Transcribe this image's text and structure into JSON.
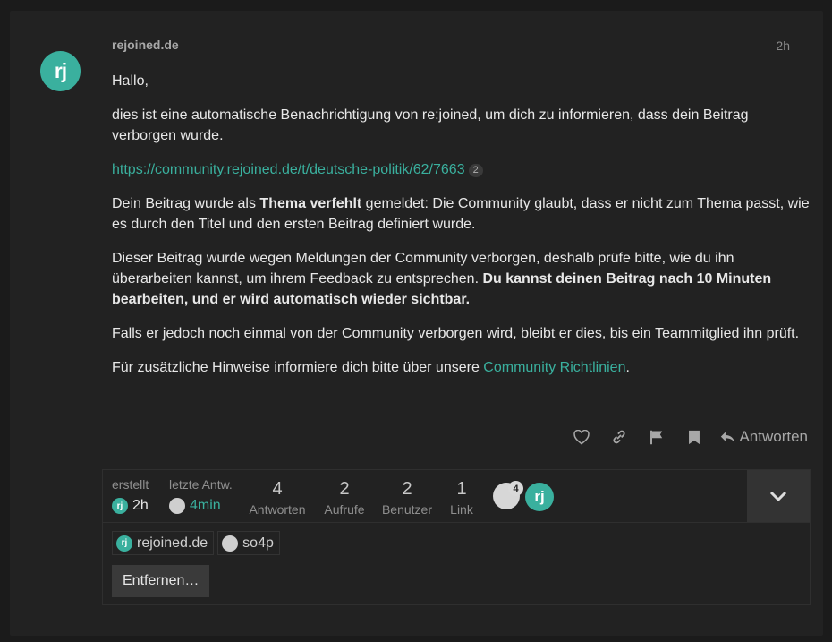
{
  "post": {
    "avatar_text": "rj",
    "username": "rejoined.de",
    "time": "2h",
    "greeting": "Hallo,",
    "intro": "dies ist eine automatische Benachrichtigung von re:joined, um dich zu informieren, dass dein Beitrag verborgen wurde.",
    "link_url": "https://community.rejoined.de/t/deutsche-politik/62/7663",
    "link_clicks": "2",
    "reason_prefix": "Dein Beitrag wurde als ",
    "reason_bold": "Thema verfehlt",
    "reason_suffix": " gemeldet: Die Community glaubt, dass er nicht zum Thema passt, wie es durch den Titel und den ersten Beitrag definiert wurde.",
    "hidden_text": "Dieser Beitrag wurde wegen Meldungen der Community verborgen, deshalb prüfe bitte, wie du ihn überarbeiten kannst, um ihrem Feedback zu entsprechen. ",
    "hidden_bold": "Du kannst deinen Beitrag nach 10 Minuten bearbeiten, und er wird automatisch wieder sichtbar.",
    "again_text": "Falls er jedoch noch einmal von der Community verborgen wird, bleibt er dies, bis ein Teammitglied ihn prüft.",
    "guidelines_prefix": "Für zusätzliche Hinweise informiere dich bitte über unsere ",
    "guidelines_link": "Community Richtlinien",
    "guidelines_suffix": "."
  },
  "actions": {
    "reply_label": "Antworten",
    "icons": [
      "heart-icon",
      "link-icon",
      "flag-icon",
      "bookmark-icon",
      "reply-icon"
    ]
  },
  "topic_map": {
    "created_label": "erstellt",
    "created_time": "2h",
    "last_reply_label": "letzte Antw.",
    "last_reply_time": "4min",
    "replies_count": "4",
    "replies_label": "Antworten",
    "views_count": "2",
    "views_label": "Aufrufe",
    "users_count": "2",
    "users_label": "Benutzer",
    "links_count": "1",
    "links_label": "Link",
    "poster_badge": "4",
    "poster_avatar_text": "rj",
    "participants": [
      {
        "name": "rejoined.de",
        "avatar": "rj"
      },
      {
        "name": "so4p",
        "avatar": ""
      }
    ],
    "remove_label": "Entfernen…"
  },
  "colors": {
    "accent": "#3ab09e",
    "background": "#222222"
  }
}
